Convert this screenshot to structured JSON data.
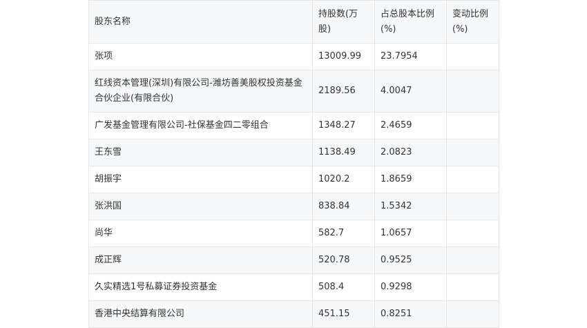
{
  "table": {
    "headers": [
      "股东名称",
      "持股数(万股)",
      "占总股本比例(%)",
      "变动比例(%)"
    ],
    "rows": [
      {
        "name": "张项",
        "shares": "13009.99",
        "ratio": "23.7954",
        "change": ""
      },
      {
        "name": "红线资本管理(深圳)有限公司-潍坊善美股权投资基金合伙企业(有限合伙)",
        "shares": "2189.56",
        "ratio": "4.0047",
        "change": ""
      },
      {
        "name": "广发基金管理有限公司-社保基金四二零组合",
        "shares": "1348.27",
        "ratio": "2.4659",
        "change": ""
      },
      {
        "name": "王东雪",
        "shares": "1138.49",
        "ratio": "2.0823",
        "change": ""
      },
      {
        "name": "胡振宇",
        "shares": "1020.2",
        "ratio": "1.8659",
        "change": ""
      },
      {
        "name": "张洪国",
        "shares": "838.84",
        "ratio": "1.5342",
        "change": ""
      },
      {
        "name": "尚华",
        "shares": "582.7",
        "ratio": "1.0657",
        "change": ""
      },
      {
        "name": "成正辉",
        "shares": "520.78",
        "ratio": "0.9525",
        "change": ""
      },
      {
        "name": "久实精选1号私募证券投资基金",
        "shares": "508.4",
        "ratio": "0.9298",
        "change": ""
      },
      {
        "name": "香港中央结算有限公司",
        "shares": "451.15",
        "ratio": "0.8251",
        "change": ""
      }
    ]
  }
}
